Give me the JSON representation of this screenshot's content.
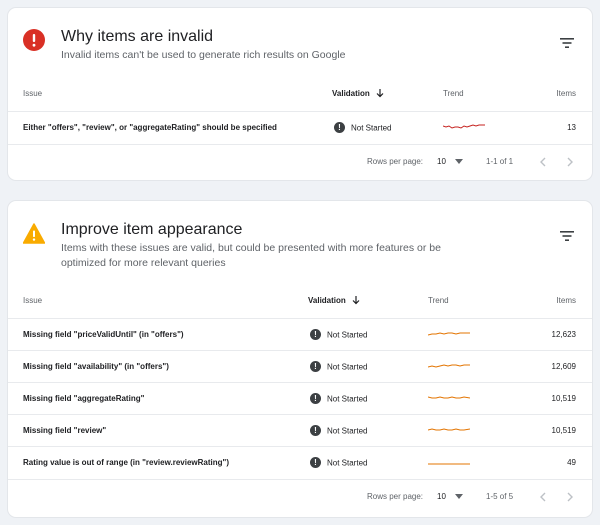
{
  "colors": {
    "error_red": "#d93025",
    "warning_yellow": "#f9ab00",
    "trend_red": "#c5221f",
    "trend_orange": "#e37400"
  },
  "invalid_card": {
    "icon": "error-icon",
    "title": "Why items are invalid",
    "description": "Invalid items can't be used to generate rich results on Google",
    "columns": {
      "issue": "Issue",
      "validation": "Validation",
      "trend": "Trend",
      "items": "Items"
    },
    "rows": [
      {
        "issue": "Either \"offers\", \"review\", or \"aggregateRating\" should be specified",
        "validation": "Not Started",
        "items": "13"
      }
    ],
    "footer": {
      "rows_per_page_label": "Rows per page:",
      "rows_per_page_value": "10",
      "range": "1-1 of 1"
    }
  },
  "appearance_card": {
    "icon": "warning-icon",
    "title": "Improve item appearance",
    "description": "Items with these issues are valid, but could be presented with more features or be optimized for more relevant queries",
    "columns": {
      "issue": "Issue",
      "validation": "Validation",
      "trend": "Trend",
      "items": "Items"
    },
    "rows": [
      {
        "issue": "Missing field \"priceValidUntil\" (in \"offers\")",
        "validation": "Not Started",
        "items": "12,623"
      },
      {
        "issue": "Missing field \"availability\" (in \"offers\")",
        "validation": "Not Started",
        "items": "12,609"
      },
      {
        "issue": "Missing field \"aggregateRating\"",
        "validation": "Not Started",
        "items": "10,519"
      },
      {
        "issue": "Missing field \"review\"",
        "validation": "Not Started",
        "items": "10,519"
      },
      {
        "issue": "Rating value is out of range (in \"review.reviewRating\")",
        "validation": "Not Started",
        "items": "49"
      }
    ],
    "footer": {
      "rows_per_page_label": "Rows per page:",
      "rows_per_page_value": "10",
      "range": "1-5 of 5"
    }
  }
}
